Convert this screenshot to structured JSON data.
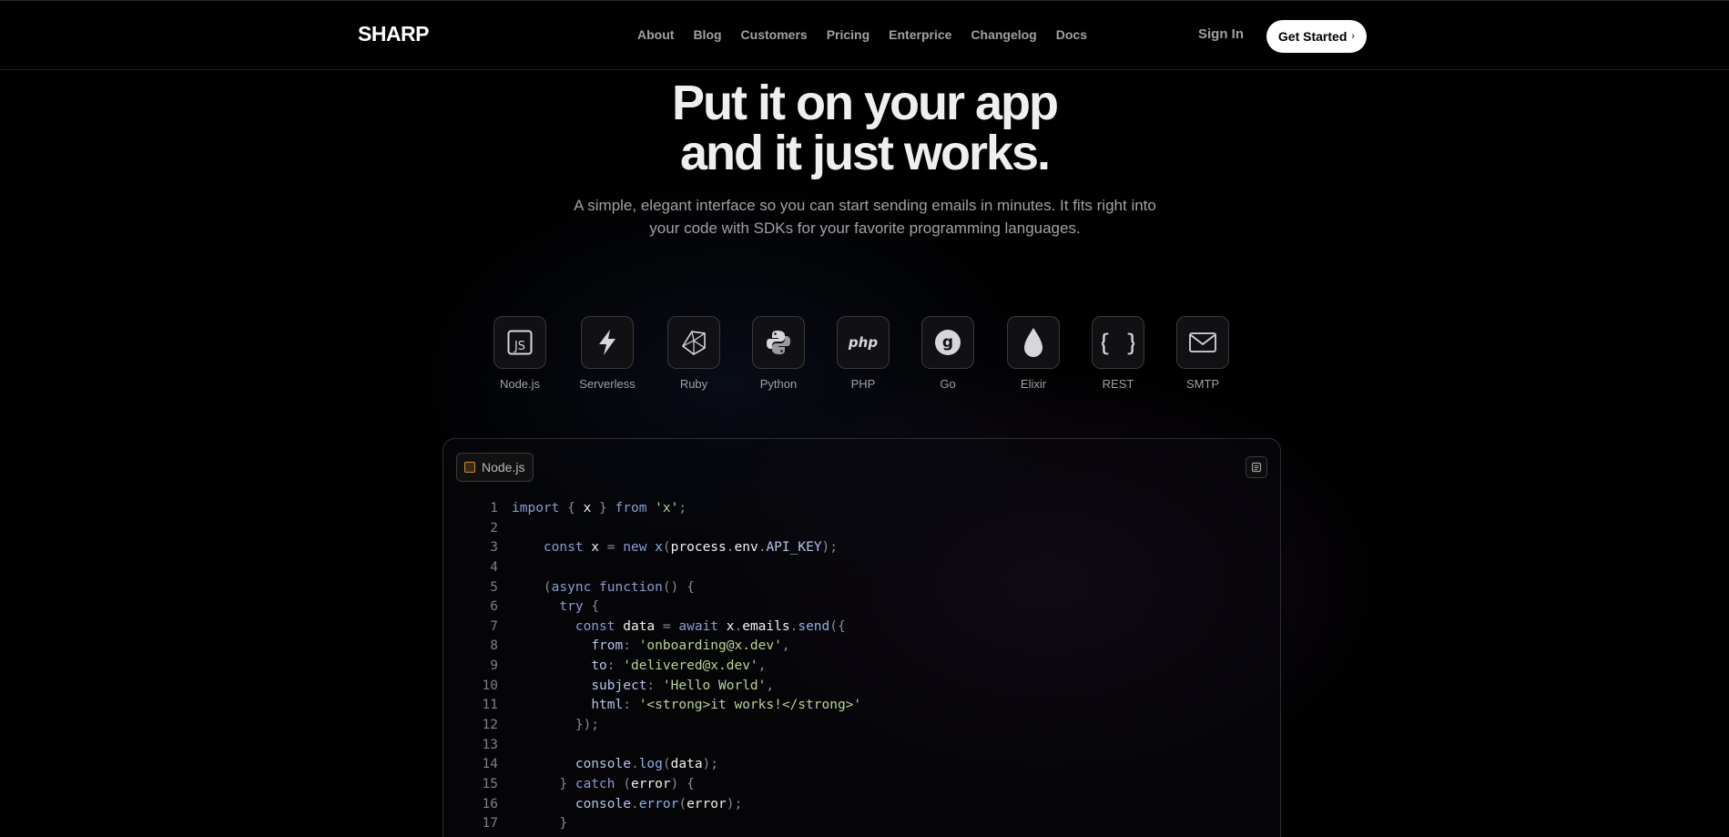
{
  "nav": {
    "logo": "SHARP",
    "links": [
      "About",
      "Blog",
      "Customers",
      "Pricing",
      "Enterprice",
      "Changelog",
      "Docs"
    ],
    "sign_in": "Sign In",
    "cta": "Get Started",
    "cta_chevron": "›"
  },
  "hero": {
    "title_line1": "Put it on your app",
    "title_line2": "and it just works.",
    "subtitle": "A simple, elegant interface so you can start sending emails in minutes. It fits right into your code with SDKs for your favorite programming languages."
  },
  "sdks": [
    {
      "label": "Node.js",
      "icon": "nodejs-icon"
    },
    {
      "label": "Serverless",
      "icon": "lightning-icon"
    },
    {
      "label": "Ruby",
      "icon": "ruby-icon"
    },
    {
      "label": "Python",
      "icon": "python-icon"
    },
    {
      "label": "PHP",
      "icon": "php-icon"
    },
    {
      "label": "Go",
      "icon": "go-icon"
    },
    {
      "label": "Elixir",
      "icon": "elixir-drop-icon"
    },
    {
      "label": "REST",
      "icon": "curly-braces-icon"
    },
    {
      "label": "SMTP",
      "icon": "envelope-icon"
    }
  ],
  "code_panel": {
    "active_tab": "Node.js",
    "lines": [
      [
        [
          "kw",
          "import"
        ],
        [
          "p",
          " { "
        ],
        [
          "id",
          "x"
        ],
        [
          "p",
          " } "
        ],
        [
          "kw",
          "from"
        ],
        [
          "str",
          " 'x'"
        ],
        [
          "p",
          ";"
        ]
      ],
      [],
      [
        [
          "p",
          "    "
        ],
        [
          "kw",
          "const"
        ],
        [
          "id",
          " x"
        ],
        [
          "p",
          " = "
        ],
        [
          "kw",
          "new"
        ],
        [
          "fn",
          " x"
        ],
        [
          "p",
          "("
        ],
        [
          "id",
          "process"
        ],
        [
          "p",
          "."
        ],
        [
          "id",
          "env"
        ],
        [
          "p",
          "."
        ],
        [
          "prop",
          "API_KEY"
        ],
        [
          "p",
          ");"
        ]
      ],
      [],
      [
        [
          "p",
          "    ("
        ],
        [
          "kw",
          "async function"
        ],
        [
          "p",
          "() {"
        ]
      ],
      [
        [
          "p",
          "      "
        ],
        [
          "kw",
          "try"
        ],
        [
          "p",
          " {"
        ]
      ],
      [
        [
          "p",
          "        "
        ],
        [
          "kw",
          "const"
        ],
        [
          "id",
          " data"
        ],
        [
          "p",
          " = "
        ],
        [
          "kw",
          "await"
        ],
        [
          "id",
          " x"
        ],
        [
          "p",
          "."
        ],
        [
          "id",
          "emails"
        ],
        [
          "p",
          "."
        ],
        [
          "fn",
          "send"
        ],
        [
          "p",
          "({"
        ]
      ],
      [
        [
          "p",
          "          "
        ],
        [
          "prop",
          "from"
        ],
        [
          "p",
          ": "
        ],
        [
          "str",
          "'onboarding@x.dev'"
        ],
        [
          "p",
          ","
        ]
      ],
      [
        [
          "p",
          "          "
        ],
        [
          "prop",
          "to"
        ],
        [
          "p",
          ": "
        ],
        [
          "str",
          "'delivered@x.dev'"
        ],
        [
          "p",
          ","
        ]
      ],
      [
        [
          "p",
          "          "
        ],
        [
          "prop",
          "subject"
        ],
        [
          "p",
          ": "
        ],
        [
          "str",
          "'Hello World'"
        ],
        [
          "p",
          ","
        ]
      ],
      [
        [
          "p",
          "          "
        ],
        [
          "prop",
          "html"
        ],
        [
          "p",
          ": "
        ],
        [
          "str",
          "'<strong>it works!</strong>'"
        ]
      ],
      [
        [
          "p",
          "        });"
        ]
      ],
      [],
      [
        [
          "p",
          "        "
        ],
        [
          "prop",
          "console"
        ],
        [
          "p",
          "."
        ],
        [
          "fn",
          "log"
        ],
        [
          "p",
          "("
        ],
        [
          "id",
          "data"
        ],
        [
          "p",
          ");"
        ]
      ],
      [
        [
          "p",
          "      } "
        ],
        [
          "kw",
          "catch"
        ],
        [
          "p",
          " ("
        ],
        [
          "id",
          "error"
        ],
        [
          "p",
          ") {"
        ]
      ],
      [
        [
          "p",
          "        "
        ],
        [
          "prop",
          "console"
        ],
        [
          "p",
          "."
        ],
        [
          "fn",
          "error"
        ],
        [
          "p",
          "("
        ],
        [
          "id",
          "error"
        ],
        [
          "p",
          ");"
        ]
      ],
      [
        [
          "p",
          "      }"
        ]
      ]
    ]
  }
}
